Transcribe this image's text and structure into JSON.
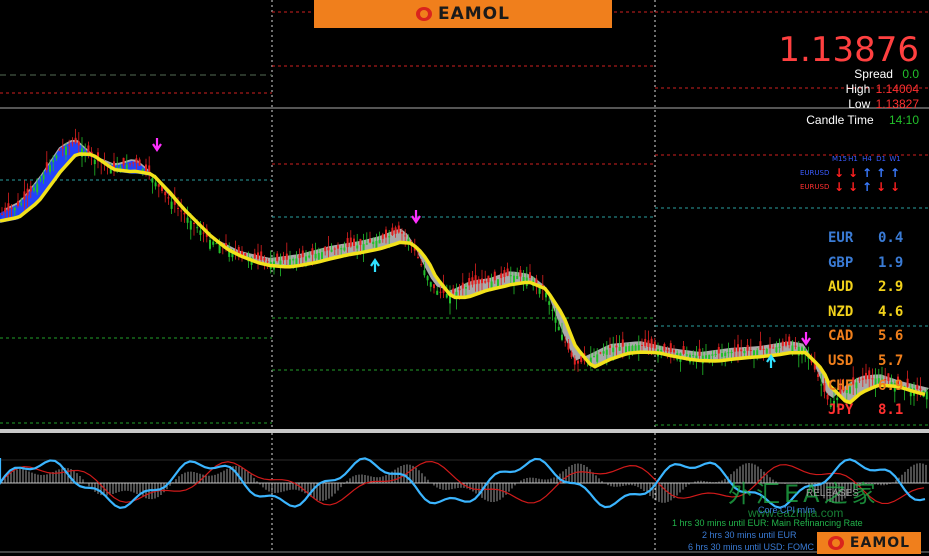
{
  "brand": {
    "logo_text": "EAMOL",
    "bottom_logo_text": "EAMOL"
  },
  "price": {
    "current": "1.13876",
    "spread_label": "Spread",
    "spread_value": "0.0",
    "high_label": "High",
    "high_value": "1.14004",
    "low_label": "Low",
    "low_value": "1.13827",
    "candle_time_label": "Candle Time",
    "candle_time_value": "14:10"
  },
  "mtf": {
    "headers": [
      "M15",
      "H1",
      "H4",
      "D1",
      "W1"
    ],
    "rows": [
      {
        "symbol": "EURUSD",
        "arrows": [
          "down",
          "down",
          "up",
          "up",
          "up"
        ]
      },
      {
        "symbol": "EURUSD",
        "arrows": [
          "down",
          "down",
          "up",
          "down",
          "down"
        ]
      }
    ]
  },
  "currencies": [
    {
      "code": "EUR",
      "value": "0.4",
      "color": "#3a7bd5"
    },
    {
      "code": "GBP",
      "value": "1.9",
      "color": "#3a7bd5"
    },
    {
      "code": "AUD",
      "value": "2.9",
      "color": "#f2d21b"
    },
    {
      "code": "NZD",
      "value": "4.6",
      "color": "#f2d21b"
    },
    {
      "code": "CAD",
      "value": "5.6",
      "color": "#f07f1c"
    },
    {
      "code": "USD",
      "value": "5.7",
      "color": "#f07f1c"
    },
    {
      "code": "CHF",
      "value": "6.9",
      "color": "#f07f1c"
    },
    {
      "code": "JPY",
      "value": "8.1",
      "color": "#ff3030"
    }
  ],
  "watermark": {
    "text": "外汇EA之家",
    "url": "www.eazhijia.com"
  },
  "releases": {
    "title": "RELEASES",
    "lines": [
      {
        "text": "Core CPI m/m",
        "color": "#3a7bd5"
      },
      {
        "text": "1 hrs 30 mins until EUR: Main Refinancing Rate",
        "color": "#22b34a"
      },
      {
        "text": "2 hrs 30 mins until EUR",
        "color": "#3a7bd5"
      },
      {
        "text": "6 hrs 30 mins until USD: FOMC",
        "color": "#3a7bd5"
      }
    ]
  },
  "colors": {
    "ma_fast": "#f2e21b",
    "ma_slow": "#1a3cff",
    "cloud": "#bdbdbd",
    "bull": "#22c02a",
    "bear": "#e02020",
    "osc_line": "#3bb5ff",
    "osc_signal": "#d01a1a"
  }
}
